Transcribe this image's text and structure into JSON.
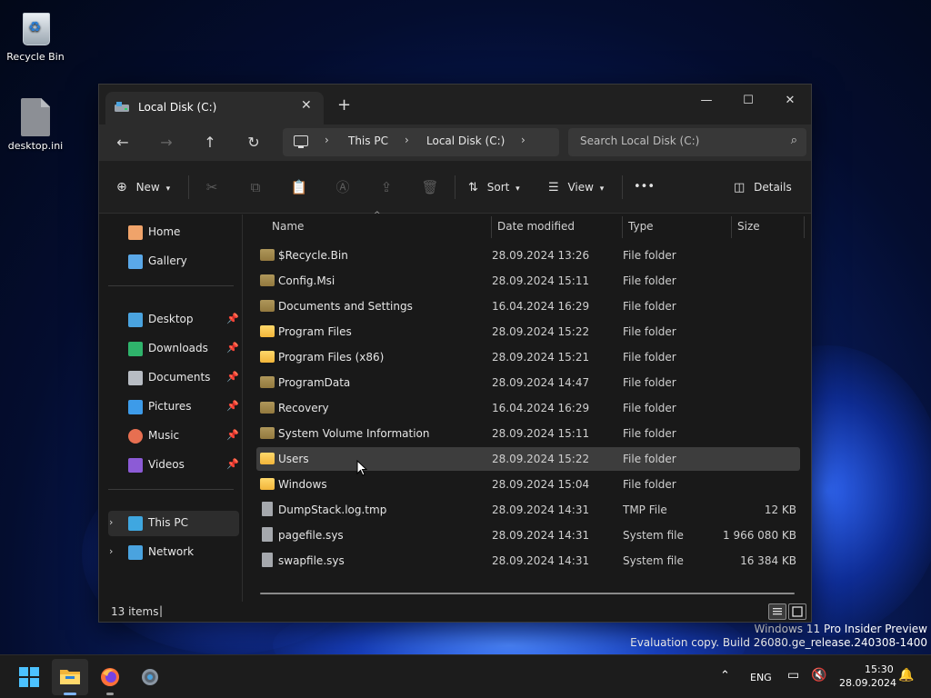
{
  "desktop": {
    "icons": [
      {
        "label": "Recycle Bin",
        "icon": "recycle-bin-icon"
      },
      {
        "label": "desktop.ini",
        "icon": "ini-file-icon"
      }
    ],
    "watermark": {
      "line1": "Windows 11 Pro Insider Preview",
      "line2": "Evaluation copy. Build 26080.ge_release.240308-1400"
    }
  },
  "window": {
    "tab_title": "Local Disk (C:)",
    "address": {
      "seg1": "This PC",
      "seg2": "Local Disk (C:)"
    },
    "search_placeholder": "Search Local Disk (C:)",
    "toolbar": {
      "new_label": "New",
      "sort_label": "Sort",
      "view_label": "View",
      "more_label": "•••",
      "details_label": "Details"
    },
    "sidebar": {
      "items": [
        {
          "label": "Home",
          "icon": "home-icon",
          "color": "#f0a36a"
        },
        {
          "label": "Gallery",
          "icon": "gallery-icon",
          "color": "#5aa8e8"
        },
        {
          "label": "Desktop",
          "icon": "desktop-icon",
          "color": "#4aa3df"
        },
        {
          "label": "Downloads",
          "icon": "download-icon",
          "color": "#2fb36b"
        },
        {
          "label": "Documents",
          "icon": "documents-icon",
          "color": "#b7bcc3"
        },
        {
          "label": "Pictures",
          "icon": "pictures-icon",
          "color": "#3d9be9"
        },
        {
          "label": "Music",
          "icon": "music-icon",
          "color": "#e76f51"
        },
        {
          "label": "Videos",
          "icon": "videos-icon",
          "color": "#8c5bd6"
        },
        {
          "label": "This PC",
          "icon": "this-pc-icon",
          "color": "#3fa7e0"
        },
        {
          "label": "Network",
          "icon": "network-icon",
          "color": "#4aa3df"
        }
      ]
    },
    "columns": {
      "name": "Name",
      "date": "Date modified",
      "type": "Type",
      "size": "Size"
    },
    "files": [
      {
        "name": "$Recycle.Bin",
        "date": "28.09.2024 13:26",
        "type": "File folder",
        "size": "",
        "kind": "folder-dim"
      },
      {
        "name": "Config.Msi",
        "date": "28.09.2024 15:11",
        "type": "File folder",
        "size": "",
        "kind": "folder-dim"
      },
      {
        "name": "Documents and Settings",
        "date": "16.04.2024 16:29",
        "type": "File folder",
        "size": "",
        "kind": "folder-link"
      },
      {
        "name": "Program Files",
        "date": "28.09.2024 15:22",
        "type": "File folder",
        "size": "",
        "kind": "folder"
      },
      {
        "name": "Program Files (x86)",
        "date": "28.09.2024 15:21",
        "type": "File folder",
        "size": "",
        "kind": "folder"
      },
      {
        "name": "ProgramData",
        "date": "28.09.2024 14:47",
        "type": "File folder",
        "size": "",
        "kind": "folder-dim"
      },
      {
        "name": "Recovery",
        "date": "16.04.2024 16:29",
        "type": "File folder",
        "size": "",
        "kind": "folder-dim"
      },
      {
        "name": "System Volume Information",
        "date": "28.09.2024 15:11",
        "type": "File folder",
        "size": "",
        "kind": "folder-dim"
      },
      {
        "name": "Users",
        "date": "28.09.2024 15:22",
        "type": "File folder",
        "size": "",
        "kind": "folder"
      },
      {
        "name": "Windows",
        "date": "28.09.2024 15:04",
        "type": "File folder",
        "size": "",
        "kind": "folder"
      },
      {
        "name": "DumpStack.log.tmp",
        "date": "28.09.2024 14:31",
        "type": "TMP File",
        "size": "12 KB",
        "kind": "file"
      },
      {
        "name": "pagefile.sys",
        "date": "28.09.2024 14:31",
        "type": "System file",
        "size": "1 966 080 KB",
        "kind": "sysfile"
      },
      {
        "name": "swapfile.sys",
        "date": "28.09.2024 14:31",
        "type": "System file",
        "size": "16 384 KB",
        "kind": "sysfile"
      }
    ],
    "selected_file": "Users",
    "status": {
      "count": "13 items"
    }
  },
  "taskbar": {
    "lang": "ENG",
    "time": "15:30",
    "date": "28.09.2024"
  },
  "colors": {
    "accent": "#4cc2ff",
    "folder": "#f2b53a",
    "window_bg": "#191919"
  }
}
